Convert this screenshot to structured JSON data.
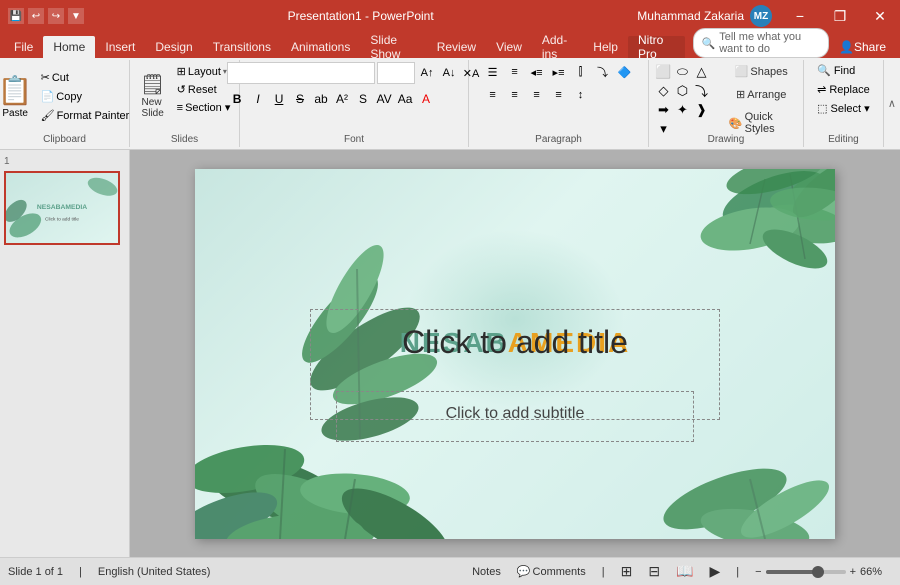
{
  "titlebar": {
    "title": "Presentation1 - PowerPoint",
    "user": "Muhammad Zakaria",
    "user_initials": "MZ",
    "save_icon": "💾",
    "undo_icon": "↩",
    "redo_icon": "↪",
    "customize_icon": "▼",
    "minimize_label": "−",
    "restore_label": "❐",
    "close_label": "✕"
  },
  "ribbon_tabs": {
    "tabs": [
      "File",
      "Home",
      "Insert",
      "Design",
      "Transitions",
      "Animations",
      "Slide Show",
      "Review",
      "View",
      "Add-ins",
      "Help",
      "Nitro Pro"
    ]
  },
  "ribbon": {
    "clipboard_label": "Clipboard",
    "slides_label": "Slides",
    "font_label": "Font",
    "paragraph_label": "Paragraph",
    "drawing_label": "Drawing",
    "editing_label": "Editing",
    "paste_label": "Paste",
    "new_slide_label": "New\nSlide",
    "layout_label": "Layout",
    "reset_label": "Reset",
    "section_label": "Section ▾",
    "font_name": "",
    "font_size": "",
    "bold": "B",
    "italic": "I",
    "underline": "U",
    "strikethrough": "S",
    "shapes_label": "Shapes",
    "arrange_label": "Arrange",
    "quick_styles_label": "Quick\nStyles",
    "find_label": "Find",
    "replace_label": "Replace",
    "select_label": "Select ▾",
    "tell_me_placeholder": "Tell me what you want to do",
    "share_label": "Share"
  },
  "slide": {
    "number": "1",
    "watermark": "NESABAMEDIA",
    "title_placeholder": "Click to add title",
    "subtitle_placeholder": "Click to add subtitle",
    "total": "1"
  },
  "statusbar": {
    "slide_info": "Slide 1 of 1",
    "language": "English (United States)",
    "notes_label": "Notes",
    "comments_label": "Comments",
    "zoom_level": "66%"
  }
}
